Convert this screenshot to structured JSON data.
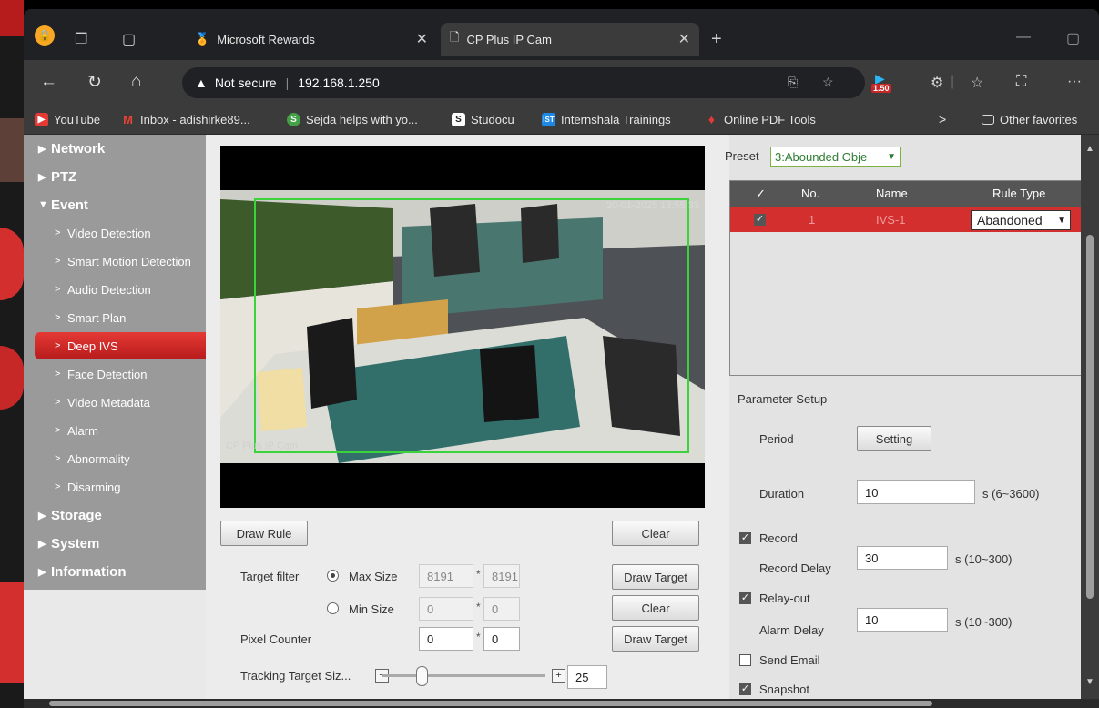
{
  "browser": {
    "tabs": [
      {
        "title": "Microsoft Rewards",
        "active": false
      },
      {
        "title": "CP Plus IP Cam",
        "active": true
      }
    ],
    "security_label": "Not secure",
    "url": "192.168.1.250",
    "extension_badge": "1.50",
    "favorites": [
      {
        "label": "YouTube",
        "icon_color": "#e53935"
      },
      {
        "label": "Inbox - adishirke89...",
        "icon_color": "#4285f4"
      },
      {
        "label": "Sejda helps with yo...",
        "icon_color": "#43a047"
      },
      {
        "label": "Studocu",
        "icon_color": "#222222"
      },
      {
        "label": "Internshala Trainings",
        "icon_color": "#1e88e5"
      },
      {
        "label": "Online PDF Tools",
        "icon_color": "#e53935"
      }
    ],
    "other_favorites": "Other favorites",
    "icons": {
      "more": "···"
    }
  },
  "sidebar": {
    "items": [
      {
        "label": "Network",
        "level": "top",
        "arrow": "▶"
      },
      {
        "label": "PTZ",
        "level": "top",
        "arrow": "▶"
      },
      {
        "label": "Event",
        "level": "top",
        "arrow": "▼"
      },
      {
        "label": "Video Detection",
        "level": "sub",
        "arrow": ">"
      },
      {
        "label": "Smart Motion Detection",
        "level": "sub",
        "arrow": ">"
      },
      {
        "label": "Audio Detection",
        "level": "sub",
        "arrow": ">"
      },
      {
        "label": "Smart Plan",
        "level": "sub",
        "arrow": ">"
      },
      {
        "label": "Deep IVS",
        "level": "sub",
        "arrow": ">",
        "active": true
      },
      {
        "label": "Face Detection",
        "level": "sub",
        "arrow": ">"
      },
      {
        "label": "Video Metadata",
        "level": "sub",
        "arrow": ">"
      },
      {
        "label": "Alarm",
        "level": "sub",
        "arrow": ">"
      },
      {
        "label": "Abnormality",
        "level": "sub",
        "arrow": ">"
      },
      {
        "label": "Disarming",
        "level": "sub",
        "arrow": ">"
      },
      {
        "label": "Storage",
        "level": "top",
        "arrow": "▶"
      },
      {
        "label": "System",
        "level": "top",
        "arrow": "▶"
      },
      {
        "label": "Information",
        "level": "top",
        "arrow": "▶"
      }
    ]
  },
  "video": {
    "timestamp": "20-01-2025 13:55:33",
    "watermark": "CP Plus IP Cam"
  },
  "controls": {
    "draw_rule": "Draw Rule",
    "clear": "Clear",
    "target_filter_label": "Target filter",
    "max_size_label": "Max Size",
    "max_w": "8191",
    "max_h": "8191",
    "min_size_label": "Min Size",
    "min_w": "0",
    "min_h": "0",
    "draw_target": "Draw Target",
    "clear2": "Clear",
    "pixel_counter_label": "Pixel Counter",
    "pixel_w": "0",
    "pixel_h": "0",
    "draw_target2": "Draw Target",
    "tracking_label": "Tracking Target Siz...",
    "tracking_value": "25",
    "star": "*"
  },
  "right": {
    "preset_label": "Preset",
    "preset_value": "3:Abounded Obje",
    "table_headers": {
      "check": "✓",
      "no": "No.",
      "name": "Name",
      "type": "Rule Type"
    },
    "rows": [
      {
        "no": "1",
        "name": "IVS-1",
        "type": "Abandoned"
      }
    ],
    "param_setup": "Parameter Setup",
    "period_label": "Period",
    "setting_btn": "Setting",
    "duration_label": "Duration",
    "duration_value": "10",
    "duration_range": "s (6~3600)",
    "record_label": "Record",
    "record_delay_label": "Record Delay",
    "record_delay_value": "30",
    "record_delay_range": "s (10~300)",
    "relay_label": "Relay-out",
    "alarm_delay_label": "Alarm Delay",
    "alarm_delay_value": "10",
    "alarm_delay_range": "s (10~300)",
    "send_email_label": "Send Email",
    "snapshot_label": "Snapshot",
    "checks": {
      "record": true,
      "relay": true,
      "email": false,
      "snapshot": true
    }
  }
}
